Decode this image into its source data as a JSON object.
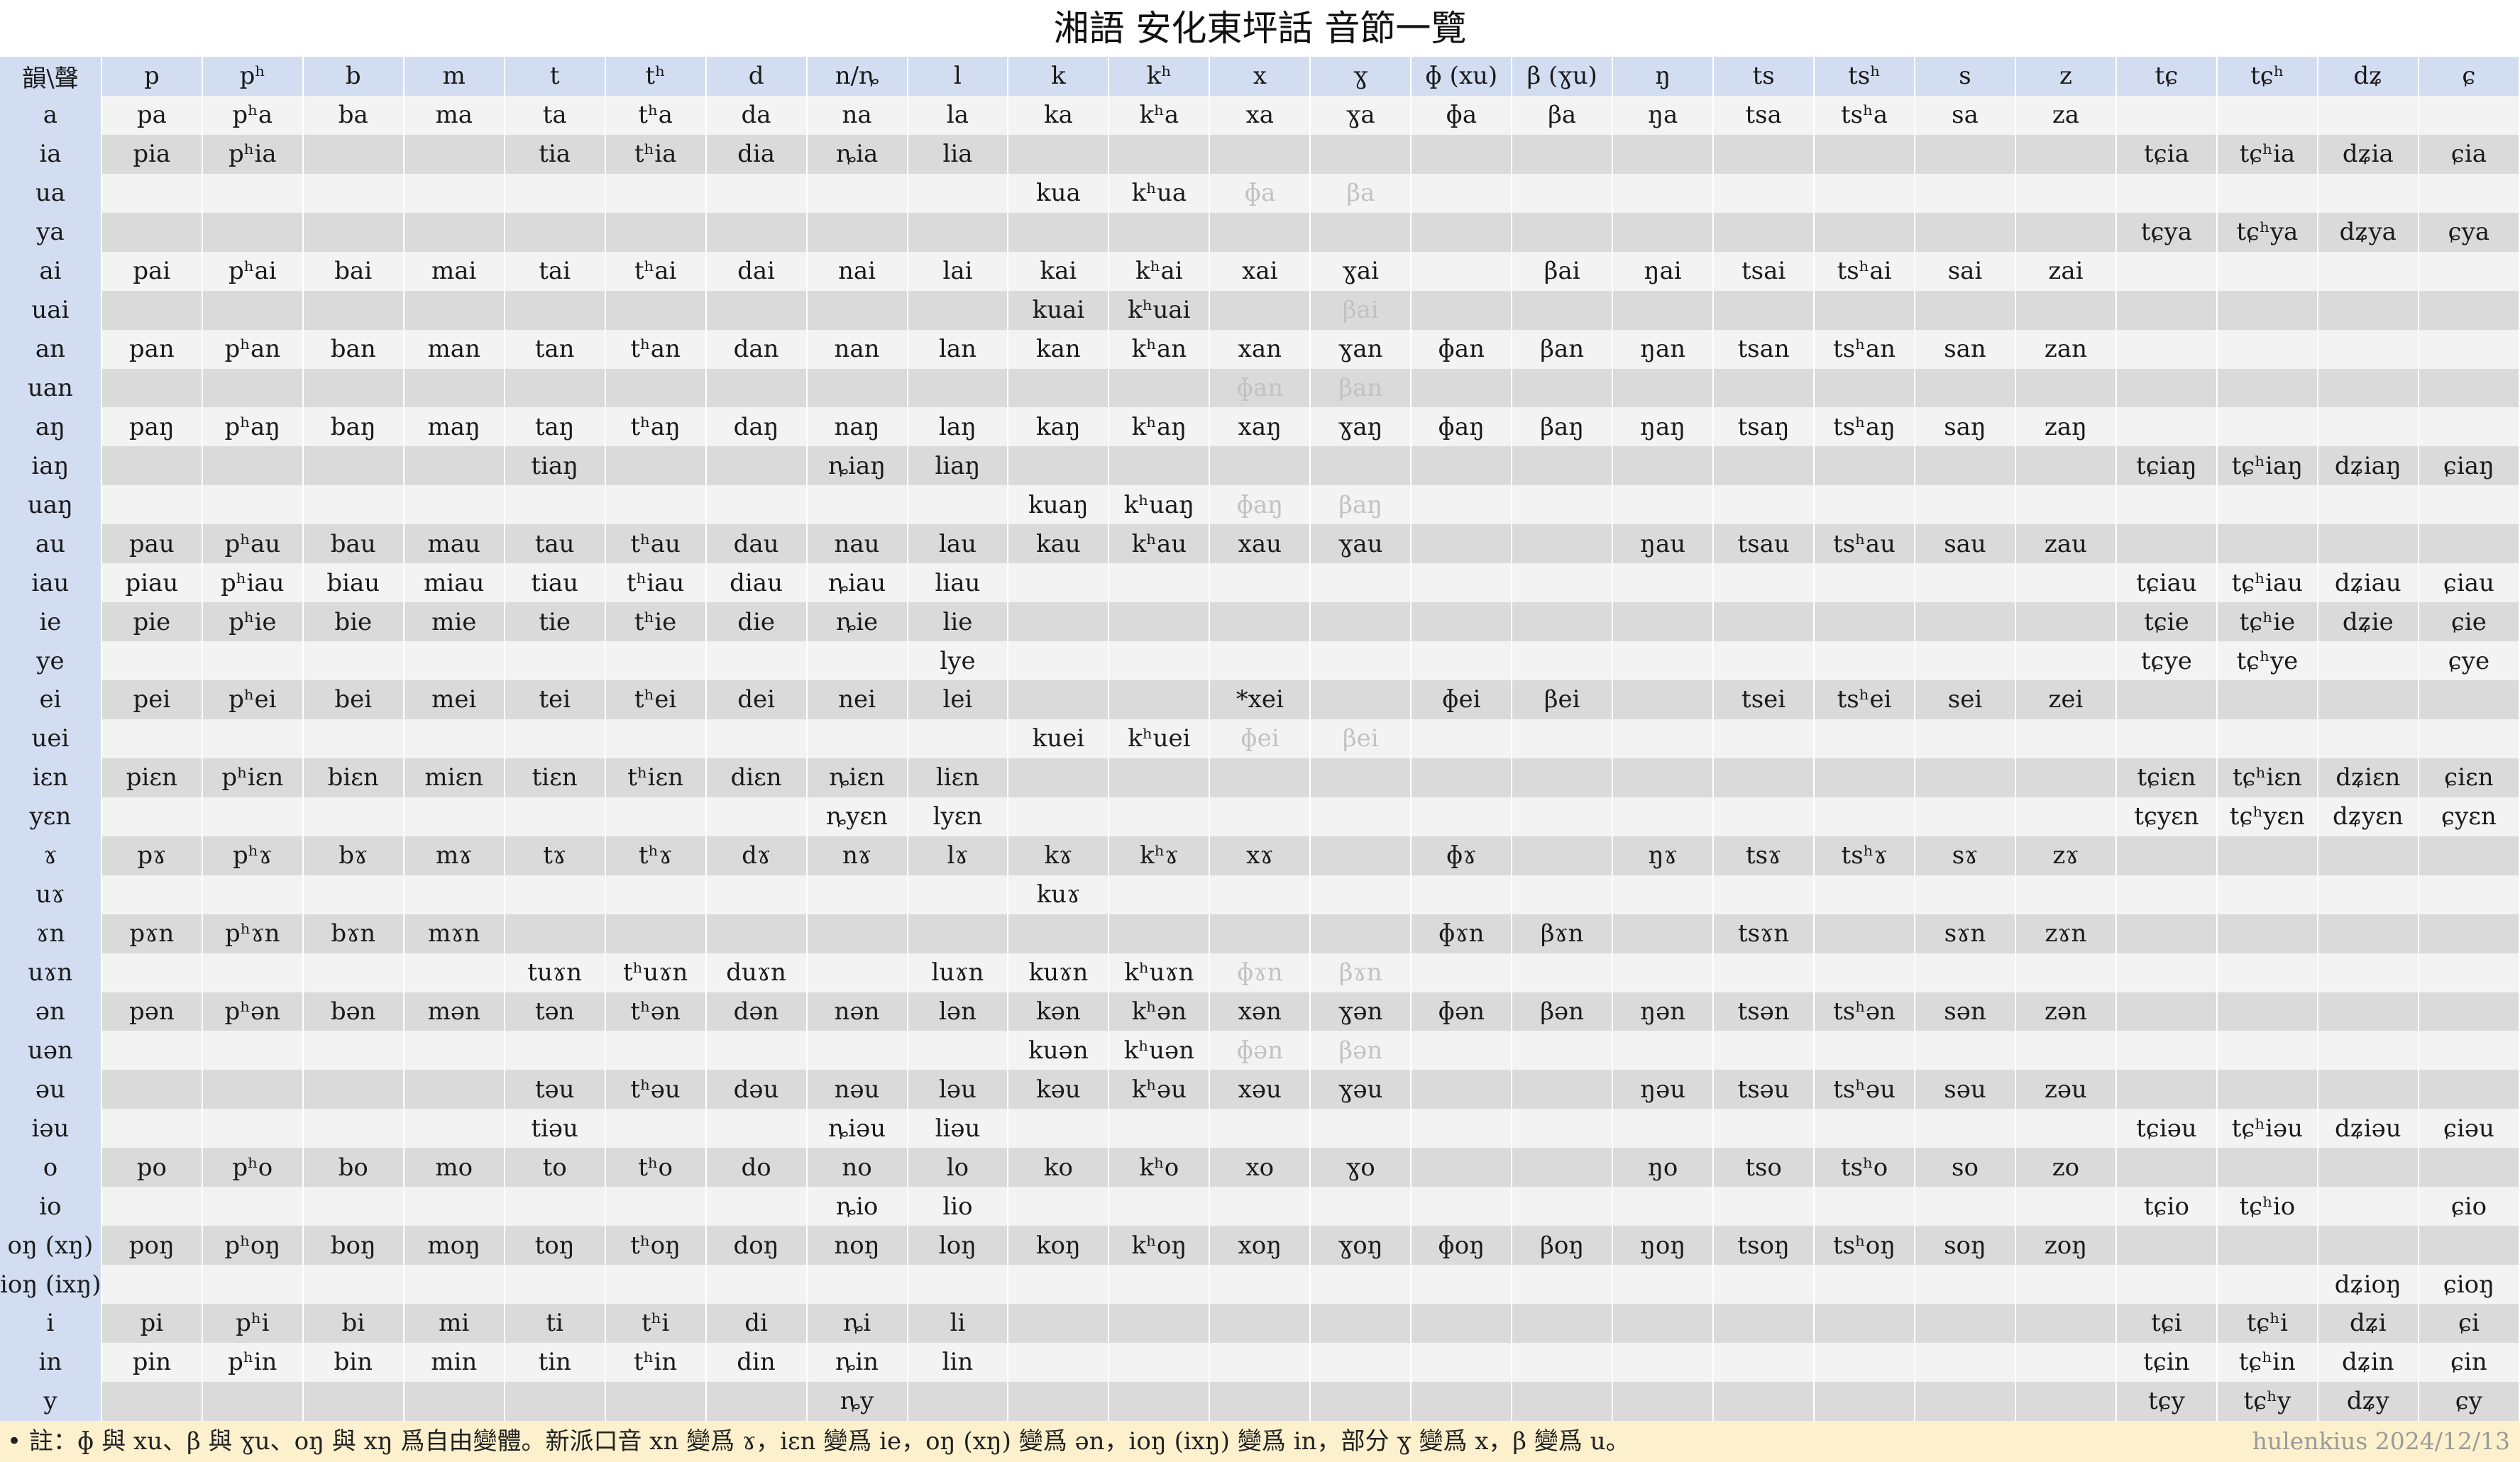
{
  "title": "湘語 安化東坪話 音節一覽",
  "corner_label": "韻\\聲",
  "initials": [
    "p",
    "pʰ",
    "b",
    "m",
    "t",
    "tʰ",
    "d",
    "n/ȵ",
    "l",
    "k",
    "kʰ",
    "x",
    "ɣ",
    "ɸ (xu)",
    "β (ɣu)",
    "ŋ",
    "ts",
    "tsʰ",
    "s",
    "z",
    "tɕ",
    "tɕʰ",
    "dʑ",
    "ɕ"
  ],
  "rows": [
    {
      "final": "a",
      "cells": [
        "pa",
        "pʰa",
        "ba",
        "ma",
        "ta",
        "tʰa",
        "da",
        "na",
        "la",
        "ka",
        "kʰa",
        "xa",
        "ɣa",
        "ɸa",
        "βa",
        "ŋa",
        "tsa",
        "tsʰa",
        "sa",
        "za",
        "",
        "",
        "",
        ""
      ]
    },
    {
      "final": "ia",
      "cells": [
        "pia",
        "pʰia",
        "",
        "",
        "tia",
        "tʰia",
        "dia",
        "ȵia",
        "lia",
        "",
        "",
        "",
        "",
        "",
        "",
        "",
        "",
        "",
        "",
        "",
        "tɕia",
        "tɕʰia",
        "dʑia",
        "ɕia"
      ]
    },
    {
      "final": "ua",
      "cells": [
        "",
        "",
        "",
        "",
        "",
        "",
        "",
        "",
        "",
        "kua",
        "kʰua",
        "ɸa",
        "βa",
        "",
        "",
        "",
        "",
        "",
        "",
        "",
        "",
        "",
        "",
        ""
      ],
      "gray": [
        11,
        12
      ]
    },
    {
      "final": "ya",
      "cells": [
        "",
        "",
        "",
        "",
        "",
        "",
        "",
        "",
        "",
        "",
        "",
        "",
        "",
        "",
        "",
        "",
        "",
        "",
        "",
        "",
        "tɕya",
        "tɕʰya",
        "dʑya",
        "ɕya"
      ]
    },
    {
      "final": "ai",
      "cells": [
        "pai",
        "pʰai",
        "bai",
        "mai",
        "tai",
        "tʰai",
        "dai",
        "nai",
        "lai",
        "kai",
        "kʰai",
        "xai",
        "ɣai",
        "",
        "βai",
        "ŋai",
        "tsai",
        "tsʰai",
        "sai",
        "zai",
        "",
        "",
        "",
        ""
      ]
    },
    {
      "final": "uai",
      "cells": [
        "",
        "",
        "",
        "",
        "",
        "",
        "",
        "",
        "",
        "kuai",
        "kʰuai",
        "",
        "βai",
        "",
        "",
        "",
        "",
        "",
        "",
        "",
        "",
        "",
        "",
        ""
      ],
      "gray": [
        12
      ]
    },
    {
      "final": "an",
      "cells": [
        "pan",
        "pʰan",
        "ban",
        "man",
        "tan",
        "tʰan",
        "dan",
        "nan",
        "lan",
        "kan",
        "kʰan",
        "xan",
        "ɣan",
        "ɸan",
        "βan",
        "ŋan",
        "tsan",
        "tsʰan",
        "san",
        "zan",
        "",
        "",
        "",
        ""
      ]
    },
    {
      "final": "uan",
      "cells": [
        "",
        "",
        "",
        "",
        "",
        "",
        "",
        "",
        "",
        "",
        "",
        "ɸan",
        "βan",
        "",
        "",
        "",
        "",
        "",
        "",
        "",
        "",
        "",
        "",
        ""
      ],
      "gray": [
        11,
        12
      ]
    },
    {
      "final": "aŋ",
      "cells": [
        "paŋ",
        "pʰaŋ",
        "baŋ",
        "maŋ",
        "taŋ",
        "tʰaŋ",
        "daŋ",
        "naŋ",
        "laŋ",
        "kaŋ",
        "kʰaŋ",
        "xaŋ",
        "ɣaŋ",
        "ɸaŋ",
        "βaŋ",
        "ŋaŋ",
        "tsaŋ",
        "tsʰaŋ",
        "saŋ",
        "zaŋ",
        "",
        "",
        "",
        ""
      ]
    },
    {
      "final": "iaŋ",
      "cells": [
        "",
        "",
        "",
        "",
        "tiaŋ",
        "",
        "",
        "ȵiaŋ",
        "liaŋ",
        "",
        "",
        "",
        "",
        "",
        "",
        "",
        "",
        "",
        "",
        "",
        "tɕiaŋ",
        "tɕʰiaŋ",
        "dʑiaŋ",
        "ɕiaŋ"
      ]
    },
    {
      "final": "uaŋ",
      "cells": [
        "",
        "",
        "",
        "",
        "",
        "",
        "",
        "",
        "",
        "kuaŋ",
        "kʰuaŋ",
        "ɸaŋ",
        "βaŋ",
        "",
        "",
        "",
        "",
        "",
        "",
        "",
        "",
        "",
        "",
        ""
      ],
      "gray": [
        11,
        12
      ]
    },
    {
      "final": "au",
      "cells": [
        "pau",
        "pʰau",
        "bau",
        "mau",
        "tau",
        "tʰau",
        "dau",
        "nau",
        "lau",
        "kau",
        "kʰau",
        "xau",
        "ɣau",
        "",
        "",
        "ŋau",
        "tsau",
        "tsʰau",
        "sau",
        "zau",
        "",
        "",
        "",
        ""
      ]
    },
    {
      "final": "iau",
      "cells": [
        "piau",
        "pʰiau",
        "biau",
        "miau",
        "tiau",
        "tʰiau",
        "diau",
        "ȵiau",
        "liau",
        "",
        "",
        "",
        "",
        "",
        "",
        "",
        "",
        "",
        "",
        "",
        "tɕiau",
        "tɕʰiau",
        "dʑiau",
        "ɕiau"
      ]
    },
    {
      "final": "ie",
      "cells": [
        "pie",
        "pʰie",
        "bie",
        "mie",
        "tie",
        "tʰie",
        "die",
        "ȵie",
        "lie",
        "",
        "",
        "",
        "",
        "",
        "",
        "",
        "",
        "",
        "",
        "",
        "tɕie",
        "tɕʰie",
        "dʑie",
        "ɕie"
      ]
    },
    {
      "final": "ye",
      "cells": [
        "",
        "",
        "",
        "",
        "",
        "",
        "",
        "",
        "lye",
        "",
        "",
        "",
        "",
        "",
        "",
        "",
        "",
        "",
        "",
        "",
        "tɕye",
        "tɕʰye",
        "",
        "ɕye"
      ]
    },
    {
      "final": "ei",
      "cells": [
        "pei",
        "pʰei",
        "bei",
        "mei",
        "tei",
        "tʰei",
        "dei",
        "nei",
        "lei",
        "",
        "",
        "*xei",
        "",
        "ɸei",
        "βei",
        "",
        "tsei",
        "tsʰei",
        "sei",
        "zei",
        "",
        "",
        "",
        ""
      ]
    },
    {
      "final": "uei",
      "cells": [
        "",
        "",
        "",
        "",
        "",
        "",
        "",
        "",
        "",
        "kuei",
        "kʰuei",
        "ɸei",
        "βei",
        "",
        "",
        "",
        "",
        "",
        "",
        "",
        "",
        "",
        "",
        ""
      ],
      "gray": [
        11,
        12
      ]
    },
    {
      "final": "iɛn",
      "cells": [
        "piɛn",
        "pʰiɛn",
        "biɛn",
        "miɛn",
        "tiɛn",
        "tʰiɛn",
        "diɛn",
        "ȵiɛn",
        "liɛn",
        "",
        "",
        "",
        "",
        "",
        "",
        "",
        "",
        "",
        "",
        "",
        "tɕiɛn",
        "tɕʰiɛn",
        "dʑiɛn",
        "ɕiɛn"
      ]
    },
    {
      "final": "yɛn",
      "cells": [
        "",
        "",
        "",
        "",
        "",
        "",
        "",
        "ȵyɛn",
        "lyɛn",
        "",
        "",
        "",
        "",
        "",
        "",
        "",
        "",
        "",
        "",
        "",
        "tɕyɛn",
        "tɕʰyɛn",
        "dʑyɛn",
        "ɕyɛn"
      ]
    },
    {
      "final": "ɤ",
      "cells": [
        "pɤ",
        "pʰɤ",
        "bɤ",
        "mɤ",
        "tɤ",
        "tʰɤ",
        "dɤ",
        "nɤ",
        "lɤ",
        "kɤ",
        "kʰɤ",
        "xɤ",
        "",
        "ɸɤ",
        "",
        "ŋɤ",
        "tsɤ",
        "tsʰɤ",
        "sɤ",
        "zɤ",
        "",
        "",
        "",
        ""
      ]
    },
    {
      "final": "uɤ",
      "cells": [
        "",
        "",
        "",
        "",
        "",
        "",
        "",
        "",
        "",
        "kuɤ",
        "",
        "",
        "",
        "",
        "",
        "",
        "",
        "",
        "",
        "",
        "",
        "",
        "",
        ""
      ]
    },
    {
      "final": "ɤn",
      "cells": [
        "pɤn",
        "pʰɤn",
        "bɤn",
        "mɤn",
        "",
        "",
        "",
        "",
        "",
        "",
        "",
        "",
        "",
        "ɸɤn",
        "βɤn",
        "",
        "tsɤn",
        "",
        "sɤn",
        "zɤn",
        "",
        "",
        "",
        ""
      ]
    },
    {
      "final": "uɤn",
      "cells": [
        "",
        "",
        "",
        "",
        "tuɤn",
        "tʰuɤn",
        "duɤn",
        "",
        "luɤn",
        "kuɤn",
        "kʰuɤn",
        "ɸɤn",
        "βɤn",
        "",
        "",
        "",
        "",
        "",
        "",
        "",
        "",
        "",
        "",
        ""
      ],
      "gray": [
        11,
        12
      ]
    },
    {
      "final": "ən",
      "cells": [
        "pən",
        "pʰən",
        "bən",
        "mən",
        "tən",
        "tʰən",
        "dən",
        "nən",
        "lən",
        "kən",
        "kʰən",
        "xən",
        "ɣən",
        "ɸən",
        "βən",
        "ŋən",
        "tsən",
        "tsʰən",
        "sən",
        "zən",
        "",
        "",
        "",
        ""
      ]
    },
    {
      "final": "uən",
      "cells": [
        "",
        "",
        "",
        "",
        "",
        "",
        "",
        "",
        "",
        "kuən",
        "kʰuən",
        "ɸən",
        "βən",
        "",
        "",
        "",
        "",
        "",
        "",
        "",
        "",
        "",
        "",
        ""
      ],
      "gray": [
        11,
        12
      ]
    },
    {
      "final": "əu",
      "cells": [
        "",
        "",
        "",
        "",
        "təu",
        "tʰəu",
        "dəu",
        "nəu",
        "ləu",
        "kəu",
        "kʰəu",
        "xəu",
        "ɣəu",
        "",
        "",
        "ŋəu",
        "tsəu",
        "tsʰəu",
        "səu",
        "zəu",
        "",
        "",
        "",
        ""
      ]
    },
    {
      "final": "iəu",
      "cells": [
        "",
        "",
        "",
        "",
        "tiəu",
        "",
        "",
        "ȵiəu",
        "liəu",
        "",
        "",
        "",
        "",
        "",
        "",
        "",
        "",
        "",
        "",
        "",
        "tɕiəu",
        "tɕʰiəu",
        "dʑiəu",
        "ɕiəu"
      ]
    },
    {
      "final": "o",
      "cells": [
        "po",
        "pʰo",
        "bo",
        "mo",
        "to",
        "tʰo",
        "do",
        "no",
        "lo",
        "ko",
        "kʰo",
        "xo",
        "ɣo",
        "",
        "",
        "ŋo",
        "tso",
        "tsʰo",
        "so",
        "zo",
        "",
        "",
        "",
        ""
      ]
    },
    {
      "final": "io",
      "cells": [
        "",
        "",
        "",
        "",
        "",
        "",
        "",
        "ȵio",
        "lio",
        "",
        "",
        "",
        "",
        "",
        "",
        "",
        "",
        "",
        "",
        "",
        "tɕio",
        "tɕʰio",
        "",
        "ɕio"
      ]
    },
    {
      "final": "oŋ (xŋ)",
      "cells": [
        "poŋ",
        "pʰoŋ",
        "boŋ",
        "moŋ",
        "toŋ",
        "tʰoŋ",
        "doŋ",
        "noŋ",
        "loŋ",
        "koŋ",
        "kʰoŋ",
        "xoŋ",
        "ɣoŋ",
        "ɸoŋ",
        "βoŋ",
        "ŋoŋ",
        "tsoŋ",
        "tsʰoŋ",
        "soŋ",
        "zoŋ",
        "",
        "",
        "",
        ""
      ]
    },
    {
      "final": "ioŋ (ixŋ)",
      "cells": [
        "",
        "",
        "",
        "",
        "",
        "",
        "",
        "",
        "",
        "",
        "",
        "",
        "",
        "",
        "",
        "",
        "",
        "",
        "",
        "",
        "",
        "",
        "dʑioŋ",
        "ɕioŋ"
      ]
    },
    {
      "final": "i",
      "cells": [
        "pi",
        "pʰi",
        "bi",
        "mi",
        "ti",
        "tʰi",
        "di",
        "ȵi",
        "li",
        "",
        "",
        "",
        "",
        "",
        "",
        "",
        "",
        "",
        "",
        "",
        "tɕi",
        "tɕʰi",
        "dʑi",
        "ɕi"
      ]
    },
    {
      "final": "in",
      "cells": [
        "pin",
        "pʰin",
        "bin",
        "min",
        "tin",
        "tʰin",
        "din",
        "ȵin",
        "lin",
        "",
        "",
        "",
        "",
        "",
        "",
        "",
        "",
        "",
        "",
        "",
        "tɕin",
        "tɕʰin",
        "dʑin",
        "ɕin"
      ]
    },
    {
      "final": "y",
      "cells": [
        "",
        "",
        "",
        "",
        "",
        "",
        "",
        "ȵy",
        "",
        "",
        "",
        "",
        "",
        "",
        "",
        "",
        "",
        "",
        "",
        "",
        "tɕy",
        "tɕʰy",
        "dʑy",
        "ɕy"
      ]
    }
  ],
  "footnote": "• 註：ɸ 與 xu、β 與 ɣu、oŋ 與 xŋ 爲自由變體。新派口音 xn 變爲 ɤ，iɛn 變爲 ie，oŋ (xŋ) 變爲 ən，ioŋ (ixŋ) 變爲 in，部分 ɣ 變爲 x，β 變爲 u。",
  "credit": "hulenkius 2024/12/13",
  "colors": {
    "header_bg": "#d3ddf2",
    "row_light": "#f3f3f3",
    "row_dark": "#dadada",
    "ghost_text": "#c2c2c2",
    "footnote_bg": "#fdf1cd"
  }
}
